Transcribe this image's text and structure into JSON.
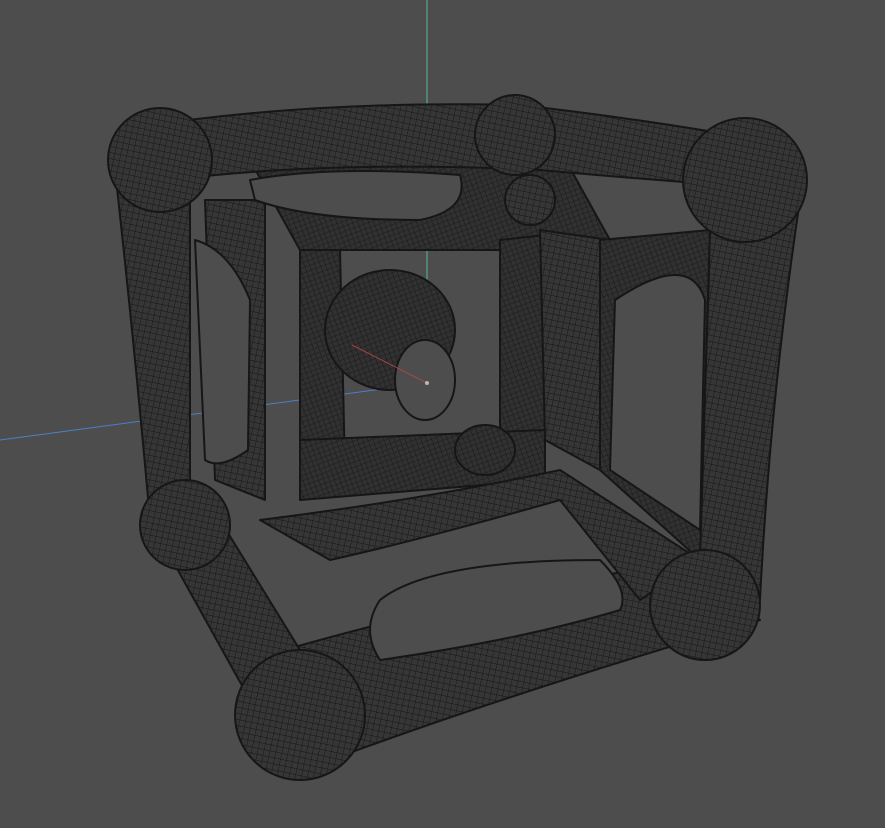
{
  "viewport": {
    "mode": "wireframe",
    "background": "#4d4d4d",
    "mesh_color": "#1c1c1c",
    "axes": {
      "x_color": "#c04848",
      "y_color": "#57b796",
      "z_color": "#4d7fc9"
    },
    "object": {
      "icon": "cube-lattice-mesh-icon"
    }
  }
}
